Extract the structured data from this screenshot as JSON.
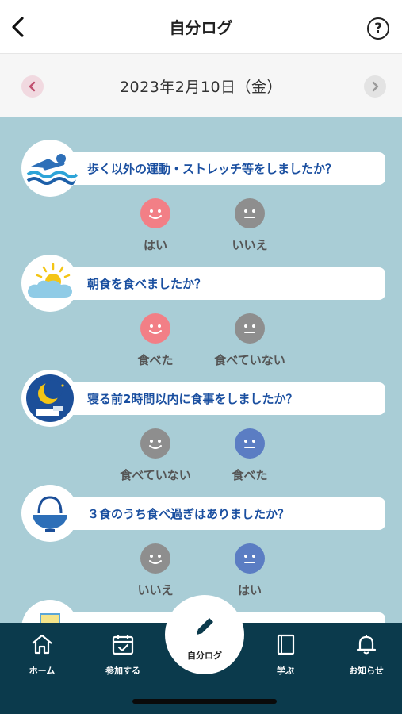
{
  "header": {
    "title": "自分ログ",
    "help_label": "?"
  },
  "date": {
    "text": "2023年2月10日（金）"
  },
  "questions": [
    {
      "text": "歩く以外の運動・ストレッチ等をしましたか？",
      "icon": "swimmer-icon",
      "choices": [
        {
          "label": "はい",
          "face": "smile",
          "color": "pink"
        },
        {
          "label": "いいえ",
          "face": "neutral",
          "color": "gray"
        }
      ]
    },
    {
      "text": "朝食を食べましたか？",
      "icon": "sunrise-icon",
      "choices": [
        {
          "label": "食べた",
          "face": "smile",
          "color": "pink"
        },
        {
          "label": "食べていない",
          "face": "neutral",
          "color": "gray"
        }
      ]
    },
    {
      "text": "寝る前2時間以内に食事をしましたか？",
      "icon": "moon-night-icon",
      "choices": [
        {
          "label": "食べていない",
          "face": "smile",
          "color": "gray"
        },
        {
          "label": "食べた",
          "face": "neutral",
          "color": "blue"
        }
      ]
    },
    {
      "text": "３食のうち食べ過ぎはありましたか？",
      "icon": "rice-bowl-icon",
      "choices": [
        {
          "label": "いいえ",
          "face": "smile",
          "color": "gray"
        },
        {
          "label": "はい",
          "face": "neutral",
          "color": "blue"
        }
      ]
    }
  ],
  "tabs": [
    {
      "label": "ホーム",
      "icon": "home-icon"
    },
    {
      "label": "参加する",
      "icon": "calendar-check-icon"
    },
    {
      "label": "自分ログ",
      "icon": "pencil-icon"
    },
    {
      "label": "学ぶ",
      "icon": "book-icon"
    },
    {
      "label": "お知らせ",
      "icon": "bell-icon"
    }
  ],
  "colors": {
    "accent_blue": "#1a4fa0",
    "background": "#a9cdd6",
    "tabbar": "#0b3a4c",
    "pink": "#f27f86",
    "gray": "#8e8e8e",
    "blue": "#5b7dc3"
  }
}
